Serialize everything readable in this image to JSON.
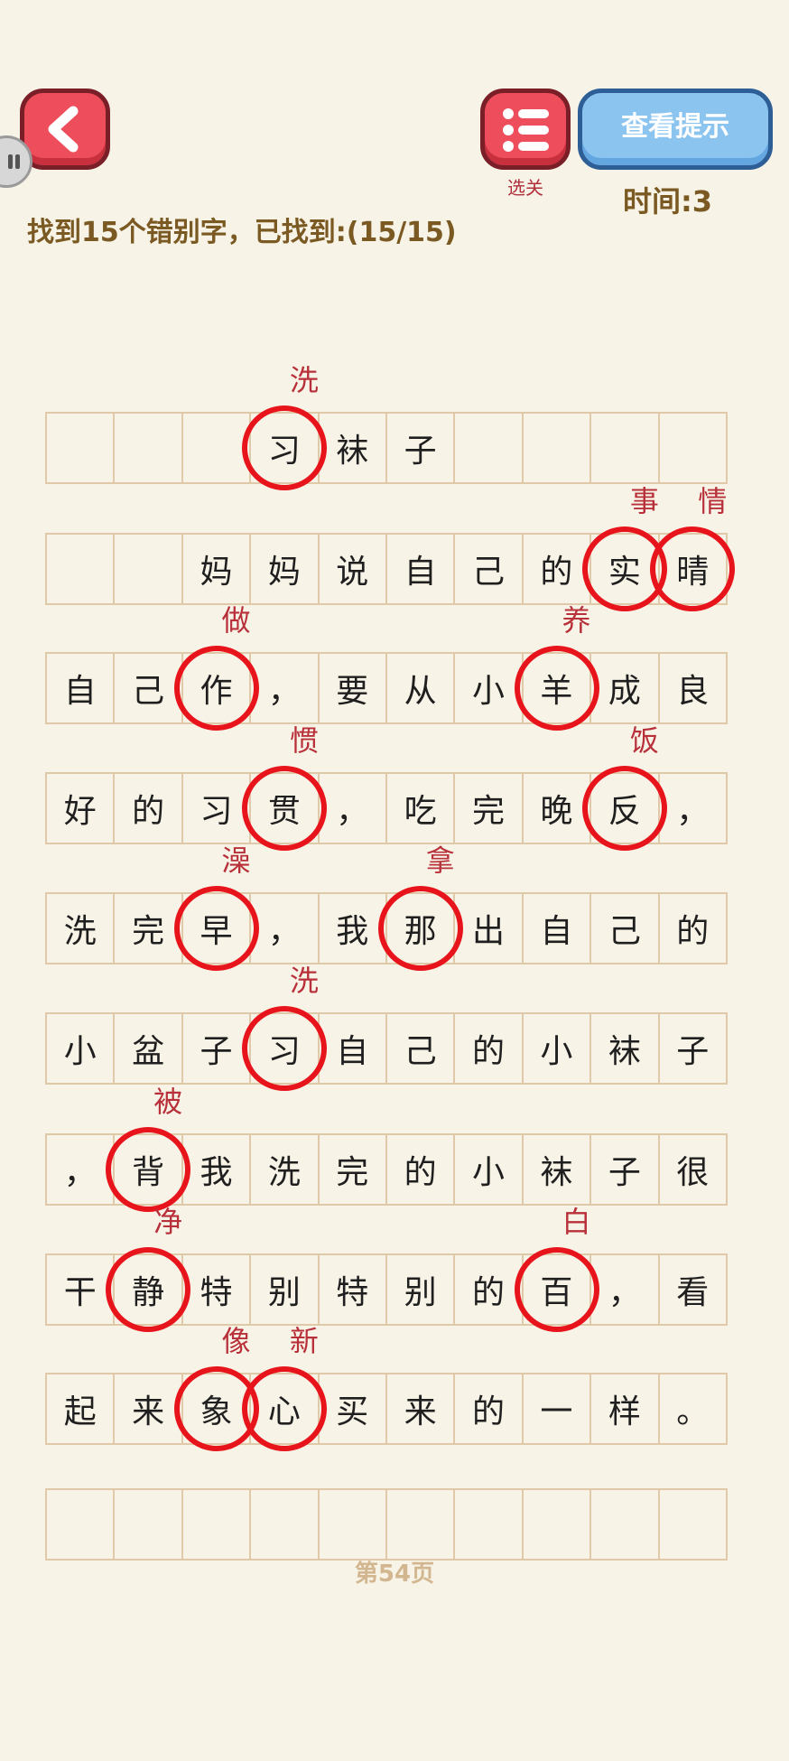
{
  "header": {
    "level_select_label": "选关",
    "hint_button_label": "查看提示",
    "timer_text": "时间:3",
    "progress_text": "找到15个错别字，已找到:(15/15)"
  },
  "grid": {
    "rows": [
      [
        "",
        "",
        "",
        "习",
        "袜",
        "子",
        "",
        "",
        "",
        ""
      ],
      [
        "",
        "",
        "妈",
        "妈",
        "说",
        "自",
        "己",
        "的",
        "实",
        "晴"
      ],
      [
        "自",
        "己",
        "作",
        "，",
        "要",
        "从",
        "小",
        "羊",
        "成",
        "良"
      ],
      [
        "好",
        "的",
        "习",
        "贯",
        "，",
        "吃",
        "完",
        "晚",
        "反",
        "，"
      ],
      [
        "洗",
        "完",
        "早",
        "，",
        "我",
        "那",
        "出",
        "自",
        "己",
        "的"
      ],
      [
        "小",
        "盆",
        "子",
        "习",
        "自",
        "己",
        "的",
        "小",
        "袜",
        "子"
      ],
      [
        "，",
        "背",
        "我",
        "洗",
        "完",
        "的",
        "小",
        "袜",
        "子",
        "很"
      ],
      [
        "干",
        "静",
        "特",
        "别",
        "特",
        "别",
        "的",
        "百",
        "，",
        "看"
      ],
      [
        "起",
        "来",
        "象",
        "心",
        "买",
        "来",
        "的",
        "一",
        "样",
        "。"
      ],
      [
        "",
        "",
        "",
        "",
        "",
        "",
        "",
        "",
        "",
        ""
      ]
    ]
  },
  "found_errors": [
    {
      "row": 0,
      "col": 3,
      "wrong": "习",
      "correct": "洗"
    },
    {
      "row": 1,
      "col": 8,
      "wrong": "实",
      "correct": "事"
    },
    {
      "row": 1,
      "col": 9,
      "wrong": "晴",
      "correct": "情"
    },
    {
      "row": 2,
      "col": 2,
      "wrong": "作",
      "correct": "做"
    },
    {
      "row": 2,
      "col": 7,
      "wrong": "羊",
      "correct": "养"
    },
    {
      "row": 3,
      "col": 3,
      "wrong": "贯",
      "correct": "惯"
    },
    {
      "row": 3,
      "col": 8,
      "wrong": "反",
      "correct": "饭"
    },
    {
      "row": 4,
      "col": 2,
      "wrong": "早",
      "correct": "澡"
    },
    {
      "row": 4,
      "col": 5,
      "wrong": "那",
      "correct": "拿"
    },
    {
      "row": 5,
      "col": 3,
      "wrong": "习",
      "correct": "洗"
    },
    {
      "row": 6,
      "col": 1,
      "wrong": "背",
      "correct": "被"
    },
    {
      "row": 7,
      "col": 1,
      "wrong": "静",
      "correct": "净"
    },
    {
      "row": 7,
      "col": 7,
      "wrong": "百",
      "correct": "白"
    },
    {
      "row": 8,
      "col": 2,
      "wrong": "象",
      "correct": "像"
    },
    {
      "row": 8,
      "col": 3,
      "wrong": "心",
      "correct": "新"
    }
  ],
  "footer": {
    "page_label": "第54页"
  },
  "colors": {
    "background": "#f8f3e7",
    "circle": "#e8141c",
    "correction": "#b8303a",
    "header_text": "#7a5a22",
    "hint_button": "#8cc4f0",
    "back_button": "#ee4e5c"
  },
  "icons": {
    "back": "chevron-left-icon",
    "level_select": "list-icon",
    "side_tab": "pause-icon"
  }
}
